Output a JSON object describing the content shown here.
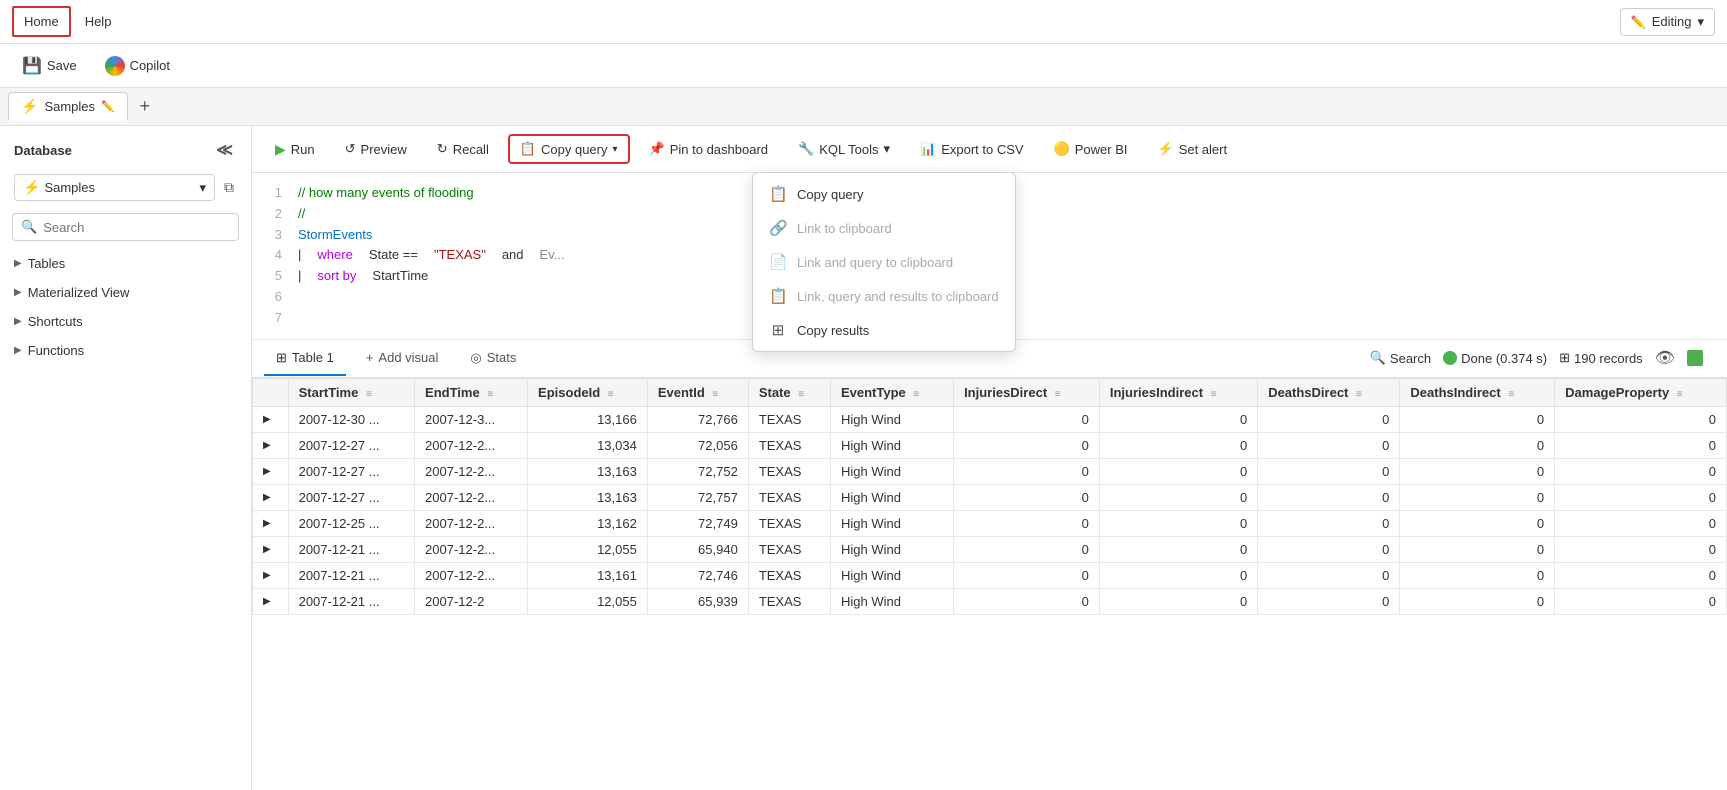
{
  "topNav": {
    "items": [
      {
        "label": "Home",
        "active": true
      },
      {
        "label": "Help",
        "active": false
      }
    ],
    "editingLabel": "Editing"
  },
  "toolbar": {
    "saveLabel": "Save",
    "copilotLabel": "Copilot"
  },
  "tabBar": {
    "tabs": [
      {
        "label": "Samples",
        "active": true
      }
    ],
    "addLabel": "+"
  },
  "sidebar": {
    "title": "Database",
    "dbName": "Samples",
    "searchPlaceholder": "Search",
    "treeItems": [
      {
        "label": "Tables"
      },
      {
        "label": "Materialized View"
      },
      {
        "label": "Shortcuts"
      },
      {
        "label": "Functions"
      }
    ]
  },
  "queryToolbar": {
    "runLabel": "Run",
    "previewLabel": "Preview",
    "recallLabel": "Recall",
    "copyQueryLabel": "Copy query",
    "pinLabel": "Pin to dashboard",
    "kqlLabel": "KQL Tools",
    "exportLabel": "Export to CSV",
    "powerBILabel": "Power BI",
    "alertLabel": "Set alert"
  },
  "copyDropdown": {
    "items": [
      {
        "label": "Copy query",
        "disabled": false,
        "icon": "📋"
      },
      {
        "label": "Link to clipboard",
        "disabled": true,
        "icon": "🔗"
      },
      {
        "label": "Link and query to clipboard",
        "disabled": true,
        "icon": "📄"
      },
      {
        "label": "Link, query and results to clipboard",
        "disabled": true,
        "icon": "📋"
      },
      {
        "label": "Copy results",
        "disabled": false,
        "icon": "⊞"
      }
    ]
  },
  "codeEditor": {
    "lines": [
      {
        "num": "1",
        "content": "// how many events of flooding",
        "type": "comment"
      },
      {
        "num": "2",
        "content": "//",
        "type": "comment"
      },
      {
        "num": "3",
        "content": "StormEvents",
        "type": "table"
      },
      {
        "num": "4",
        "content": "| where State == \"TEXAS\" and Ev...",
        "type": "mixed"
      },
      {
        "num": "5",
        "content": "| sort by StartTime",
        "type": "keyword"
      },
      {
        "num": "6",
        "content": "",
        "type": "plain"
      },
      {
        "num": "7",
        "content": "",
        "type": "plain"
      }
    ]
  },
  "results": {
    "tabs": [
      {
        "label": "Table 1",
        "active": true,
        "icon": "⊞"
      },
      {
        "label": "Add visual",
        "active": false,
        "icon": "+"
      },
      {
        "label": "Stats",
        "active": false,
        "icon": "◎"
      }
    ],
    "searchLabel": "Search",
    "statusLabel": "Done (0.374 s)",
    "recordsLabel": "190 records",
    "columns": [
      {
        "label": "StartTime"
      },
      {
        "label": "EndTime"
      },
      {
        "label": "EpisodeId"
      },
      {
        "label": "EventId"
      },
      {
        "label": "State"
      },
      {
        "label": "EventType"
      },
      {
        "label": "InjuriesDirect"
      },
      {
        "label": "InjuriesIndirect"
      },
      {
        "label": "DeathsDirect"
      },
      {
        "label": "DeathsIndirect"
      },
      {
        "label": "DamageProperty"
      }
    ],
    "rows": [
      {
        "expand": "▶",
        "StartTime": "2007-12-30 ...",
        "EndTime": "2007-12-3...",
        "EpisodeId": "13,166",
        "EventId": "72,766",
        "State": "TEXAS",
        "EventType": "High Wind",
        "InjuriesDirect": "0",
        "InjuriesIndirect": "0",
        "DeathsDirect": "0",
        "DeathsIndirect": "0",
        "DamageProperty": "0"
      },
      {
        "expand": "▶",
        "StartTime": "2007-12-27 ...",
        "EndTime": "2007-12-2...",
        "EpisodeId": "13,034",
        "EventId": "72,056",
        "State": "TEXAS",
        "EventType": "High Wind",
        "InjuriesDirect": "0",
        "InjuriesIndirect": "0",
        "DeathsDirect": "0",
        "DeathsIndirect": "0",
        "DamageProperty": "0"
      },
      {
        "expand": "▶",
        "StartTime": "2007-12-27 ...",
        "EndTime": "2007-12-2...",
        "EpisodeId": "13,163",
        "EventId": "72,752",
        "State": "TEXAS",
        "EventType": "High Wind",
        "InjuriesDirect": "0",
        "InjuriesIndirect": "0",
        "DeathsDirect": "0",
        "DeathsIndirect": "0",
        "DamageProperty": "0"
      },
      {
        "expand": "▶",
        "StartTime": "2007-12-27 ...",
        "EndTime": "2007-12-2...",
        "EpisodeId": "13,163",
        "EventId": "72,757",
        "State": "TEXAS",
        "EventType": "High Wind",
        "InjuriesDirect": "0",
        "InjuriesIndirect": "0",
        "DeathsDirect": "0",
        "DeathsIndirect": "0",
        "DamageProperty": "0"
      },
      {
        "expand": "▶",
        "StartTime": "2007-12-25 ...",
        "EndTime": "2007-12-2...",
        "EpisodeId": "13,162",
        "EventId": "72,749",
        "State": "TEXAS",
        "EventType": "High Wind",
        "InjuriesDirect": "0",
        "InjuriesIndirect": "0",
        "DeathsDirect": "0",
        "DeathsIndirect": "0",
        "DamageProperty": "0"
      },
      {
        "expand": "▶",
        "StartTime": "2007-12-21 ...",
        "EndTime": "2007-12-2...",
        "EpisodeId": "12,055",
        "EventId": "65,940",
        "State": "TEXAS",
        "EventType": "High Wind",
        "InjuriesDirect": "0",
        "InjuriesIndirect": "0",
        "DeathsDirect": "0",
        "DeathsIndirect": "0",
        "DamageProperty": "0"
      },
      {
        "expand": "▶",
        "StartTime": "2007-12-21 ...",
        "EndTime": "2007-12-2...",
        "EpisodeId": "13,161",
        "EventId": "72,746",
        "State": "TEXAS",
        "EventType": "High Wind",
        "InjuriesDirect": "0",
        "InjuriesIndirect": "0",
        "DeathsDirect": "0",
        "DeathsIndirect": "0",
        "DamageProperty": "0"
      },
      {
        "expand": "▶",
        "StartTime": "2007-12-21 ...",
        "EndTime": "2007-12-2",
        "EpisodeId": "12,055",
        "EventId": "65,939",
        "State": "TEXAS",
        "EventType": "High Wind",
        "InjuriesDirect": "0",
        "InjuriesIndirect": "0",
        "DeathsDirect": "0",
        "DeathsIndirect": "0",
        "DamageProperty": "0"
      }
    ]
  }
}
